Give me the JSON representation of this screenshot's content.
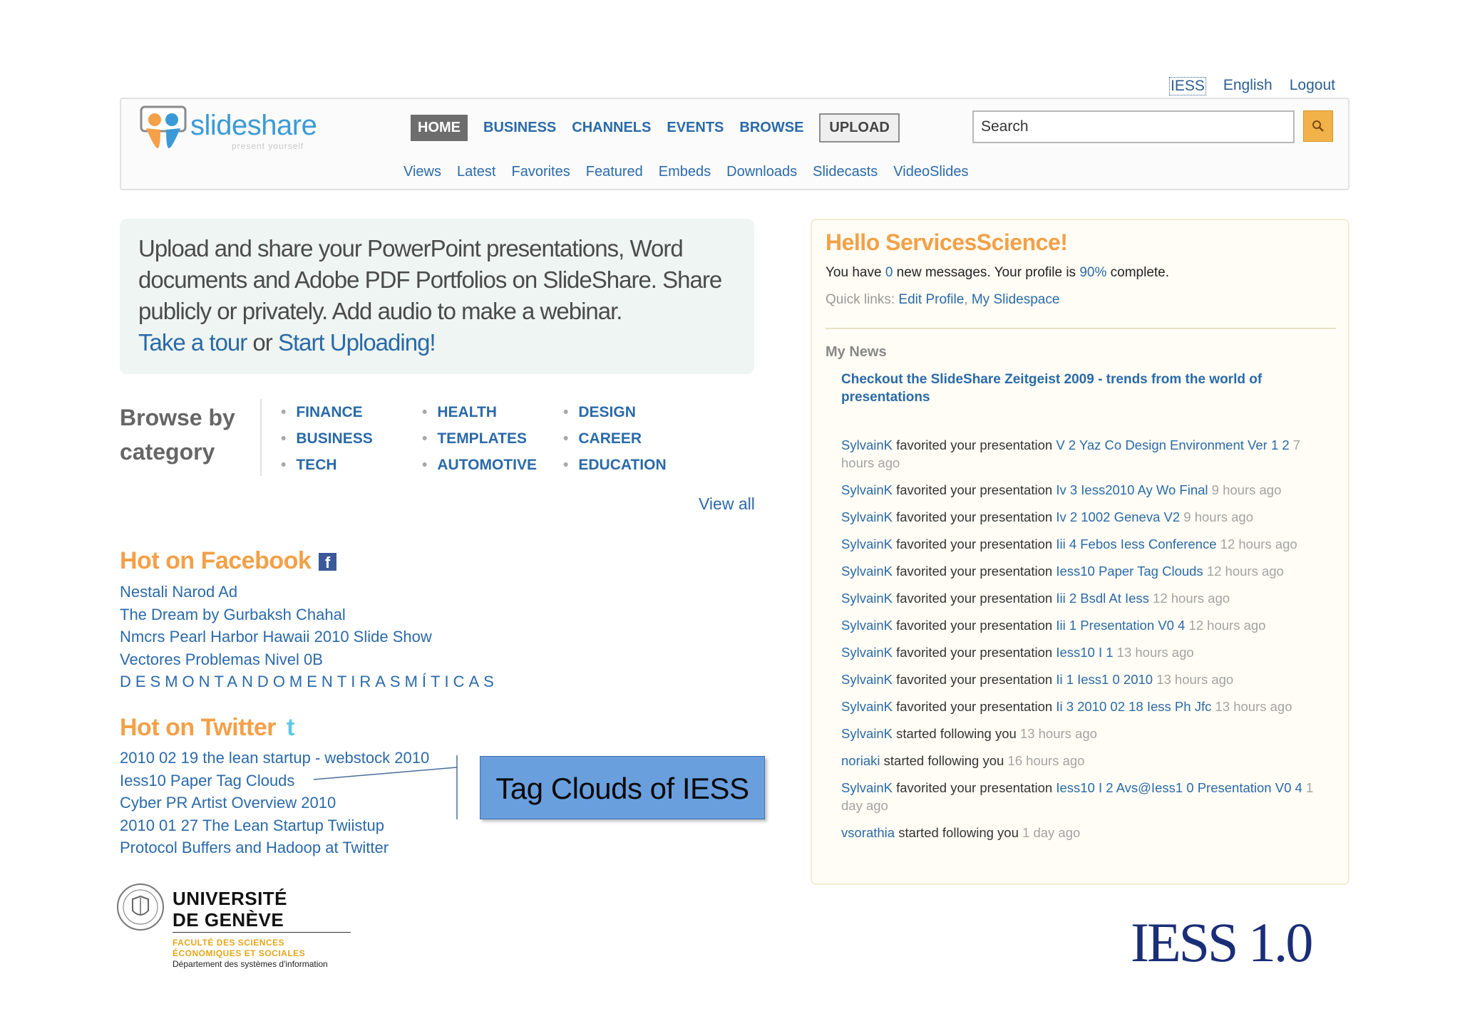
{
  "top_links": {
    "account": "IESS",
    "language": "English",
    "logout": "Logout"
  },
  "logo": {
    "name_part1": "slide",
    "name_part2": "share",
    "tagline": "present yourself"
  },
  "main_nav": [
    "HOME",
    "BUSINESS",
    "CHANNELS",
    "EVENTS",
    "BROWSE"
  ],
  "upload_label": "UPLOAD",
  "search": {
    "value": "Search"
  },
  "sub_nav": [
    "Views",
    "Latest",
    "Favorites",
    "Featured",
    "Embeds",
    "Downloads",
    "Slidecasts",
    "VideoSlides"
  ],
  "intro": {
    "text": "Upload and share your PowerPoint presentations, Word documents and Adobe PDF Portfolios on SlideShare. Share publicly or privately. Add audio to make a webinar.",
    "tour_link": "Take a tour",
    "or": " or ",
    "upload_link": "Start Uploading!"
  },
  "browse": {
    "heading": "Browse by category",
    "col1": [
      "FINANCE",
      "BUSINESS",
      "TECH"
    ],
    "col2": [
      "HEALTH",
      "TEMPLATES",
      "AUTOMOTIVE"
    ],
    "col3": [
      "DESIGN",
      "CAREER",
      "EDUCATION"
    ],
    "view_all": "View all"
  },
  "facebook": {
    "heading": "Hot on Facebook",
    "icon": "f",
    "items": [
      "Nestali Narod Ad",
      "The Dream by Gurbaksh Chahal",
      "Nmcrs Pearl Harbor Hawaii 2010 Slide Show",
      "Vectores Problemas Nivel 0B",
      "DESMONTANDOMENTIRASMÍTICAS"
    ]
  },
  "twitter": {
    "heading": "Hot on Twitter",
    "icon": "t",
    "items": [
      "2010 02 19 the lean startup - webstock 2010",
      "Iess10 Paper Tag Clouds",
      "Cyber PR Artist Overview 2010",
      "2010 01 27 The Lean Startup Twiistup",
      "Protocol Buffers and Hadoop at Twitter"
    ]
  },
  "callout": {
    "text": "Tag Clouds of IESS"
  },
  "panel": {
    "hello": "Hello ServicesScience!",
    "messages_a": "You have ",
    "messages_count": "0",
    "messages_b": " new messages. Your profile is ",
    "profile_pct": "90%",
    "messages_c": " complete.",
    "quick_label": "Quick links: ",
    "quick_edit": "Edit Profile",
    "quick_sep": ", ",
    "quick_space": "My Slidespace",
    "my_news": "My News",
    "zeitgeist": "Checkout the SlideShare Zeitgeist 2009 - trends from the world of presentations",
    "feed": [
      {
        "user": "SylvainK",
        "verb": " favorited your presentation ",
        "pres": "V 2 Yaz Co Design Environment Ver 1 2",
        "time": " 7 hours ago"
      },
      {
        "user": "SylvainK",
        "verb": " favorited your presentation ",
        "pres": "Iv 3 Iess2010 Ay Wo Final",
        "time": " 9 hours ago"
      },
      {
        "user": "SylvainK",
        "verb": " favorited your presentation ",
        "pres": "Iv 2 1002 Geneva V2",
        "time": " 9 hours ago"
      },
      {
        "user": "SylvainK",
        "verb": " favorited your presentation ",
        "pres": "Iii 4 Febos Iess Conference",
        "time": " 12 hours ago"
      },
      {
        "user": "SylvainK",
        "verb": " favorited your presentation ",
        "pres": "Iess10 Paper Tag Clouds",
        "time": " 12 hours ago"
      },
      {
        "user": "SylvainK",
        "verb": " favorited your presentation ",
        "pres": "Iii 2 Bsdl At Iess",
        "time": " 12 hours ago"
      },
      {
        "user": "SylvainK",
        "verb": " favorited your presentation ",
        "pres": "Iii 1 Presentation V0 4",
        "time": " 12 hours ago"
      },
      {
        "user": "SylvainK",
        "verb": " favorited your presentation ",
        "pres": "Iess10 I 1",
        "time": " 13 hours ago"
      },
      {
        "user": "SylvainK",
        "verb": " favorited your presentation ",
        "pres": "Ii 1 Iess1 0 2010",
        "time": " 13 hours ago"
      },
      {
        "user": "SylvainK",
        "verb": " favorited your presentation ",
        "pres": "Ii 3 2010 02 18 Iess Ph Jfc",
        "time": " 13 hours ago"
      },
      {
        "user": "SylvainK",
        "verb": " started following you",
        "pres": "",
        "time": " 13 hours ago"
      },
      {
        "user": "noriaki",
        "verb": " started following you",
        "pres": "",
        "time": " 16 hours ago"
      },
      {
        "user": "SylvainK",
        "verb": " favorited your presentation ",
        "pres": "Iess10 I 2 Avs@Iess1 0 Presentation V0 4",
        "time": " 1 day ago"
      },
      {
        "user": "vsorathia",
        "verb": " started following you",
        "pres": "",
        "time": " 1 day ago"
      }
    ]
  },
  "footer": {
    "unige_line1": "UNIVERSITÉ",
    "unige_line2": "DE GENÈVE",
    "faculty_line1": "FACULTÉ DES SCIENCES",
    "faculty_line2": "ÉCONOMIQUES ET SOCIALES",
    "department": "Département des systèmes d'information",
    "iess_logo": "IESS 1.0"
  },
  "colors": {
    "link": "#2a6aa8",
    "orange_heading": "#f3a048",
    "callout_bg": "#6a9fde",
    "iess_blue": "#1a2e78"
  }
}
